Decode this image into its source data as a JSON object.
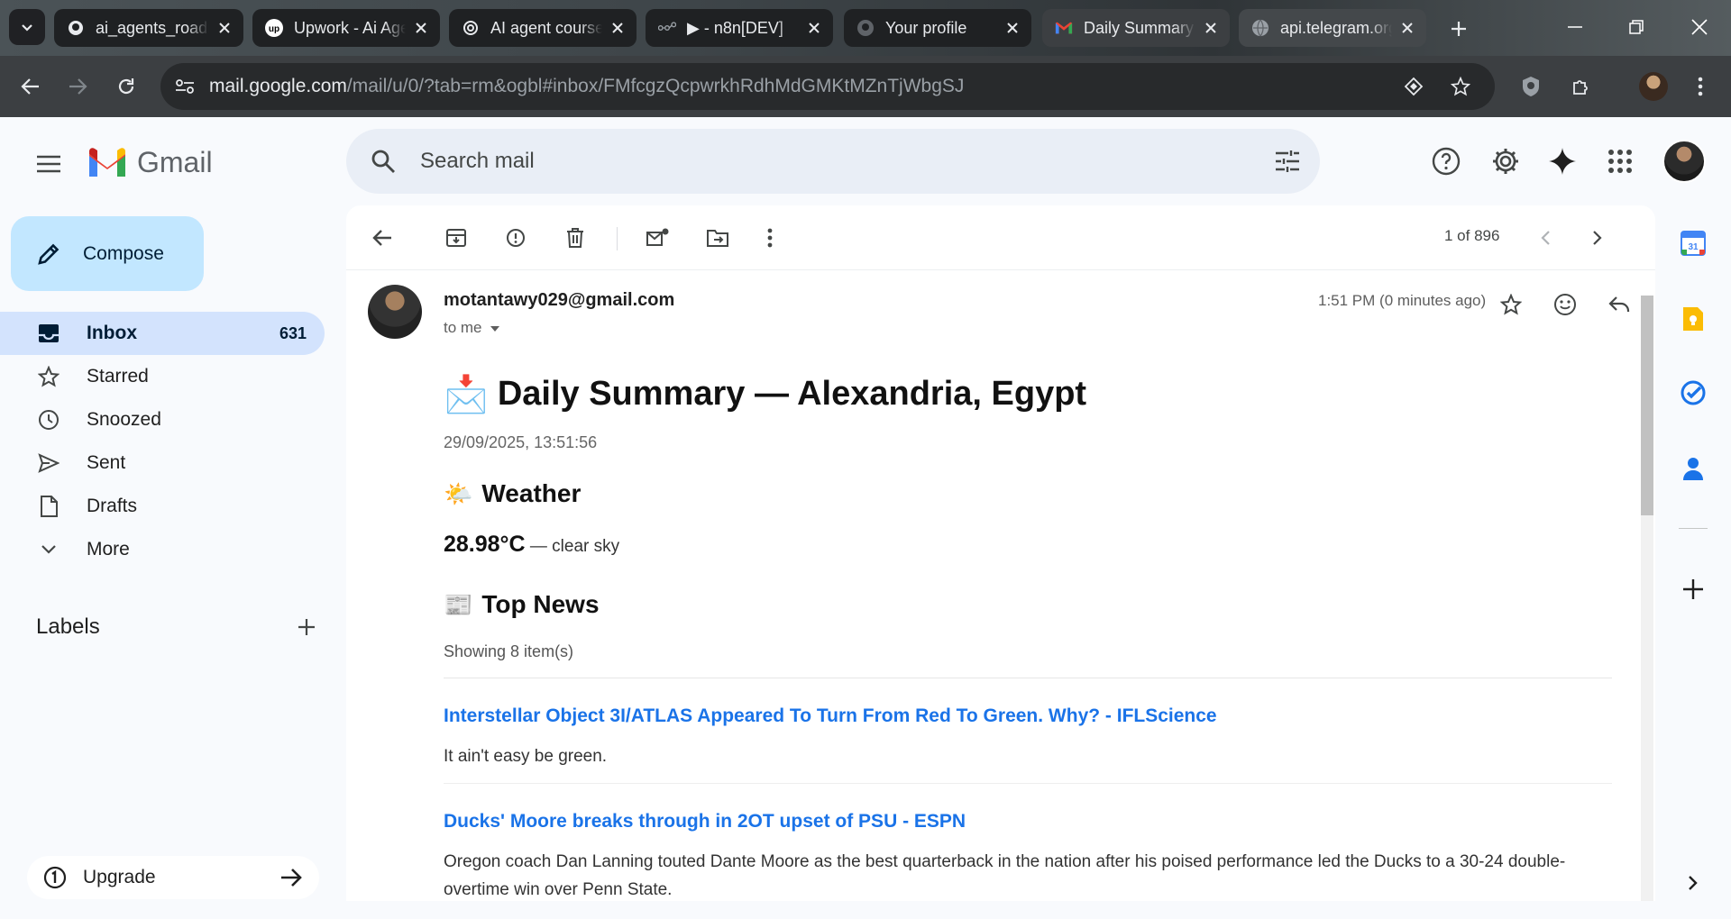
{
  "browser": {
    "tabs": [
      {
        "title": "ai_agents_roadmap",
        "icon": "github-icon"
      },
      {
        "title": "Upwork - Ai Agent",
        "icon": "upwork-icon"
      },
      {
        "title": "AI agent course",
        "icon": "openai-icon"
      },
      {
        "title": "▶ - n8n[DEV]",
        "icon": "n8n-icon"
      },
      {
        "title": "Your profile",
        "icon": "github-icon"
      },
      {
        "title": "Daily Summary",
        "icon": "gmail-icon",
        "active": true
      },
      {
        "title": "api.telegram.org",
        "icon": "globe-icon"
      }
    ],
    "url_host": "mail.google.com",
    "url_path": "/mail/u/0/?tab=rm&ogbl#inbox/FMfcgzQcpwrkhRdhMdGMKtMZnTjWbgSJ"
  },
  "gmail": {
    "logo_text": "Gmail",
    "search_placeholder": "Search mail",
    "compose_label": "Compose",
    "nav": [
      {
        "label": "Inbox",
        "count": "631",
        "icon": "inbox-icon",
        "active": true
      },
      {
        "label": "Starred",
        "count": "",
        "icon": "star-icon"
      },
      {
        "label": "Snoozed",
        "count": "",
        "icon": "clock-icon"
      },
      {
        "label": "Sent",
        "count": "",
        "icon": "send-icon"
      },
      {
        "label": "Drafts",
        "count": "",
        "icon": "draft-icon"
      },
      {
        "label": "More",
        "count": "",
        "icon": "chevron-down-icon"
      }
    ],
    "labels_title": "Labels",
    "upgrade_label": "Upgrade"
  },
  "message": {
    "pager": "1 of 896",
    "sender": "motantawy029@gmail.com",
    "to": "to me",
    "time": "1:51 PM (0 minutes ago)",
    "title_emoji": "📩",
    "title": "Daily Summary — Alexandria, Egypt",
    "date": "29/09/2025, 13:51:56",
    "weather_emoji": "🌤️",
    "weather_heading": "Weather",
    "temperature": "28.98°C",
    "condition": " — clear sky",
    "news_emoji": "📰",
    "news_heading": "Top News",
    "showing": "Showing 8 item(s)",
    "news": [
      {
        "title": "Interstellar Object 3I/ATLAS Appeared To Turn From Red To Green. Why? - IFLScience",
        "desc": "It ain't easy be green."
      },
      {
        "title": "Ducks' Moore breaks through in 2OT upset of PSU - ESPN",
        "desc": "Oregon coach Dan Lanning touted Dante Moore as the best quarterback in the nation after his poised performance led the Ducks to a 30-24 double-overtime win over Penn State."
      }
    ]
  },
  "colors": {
    "accent": "#1a73e8",
    "compose_bg": "#c2e7ff",
    "active_nav": "#d3e3fd"
  }
}
